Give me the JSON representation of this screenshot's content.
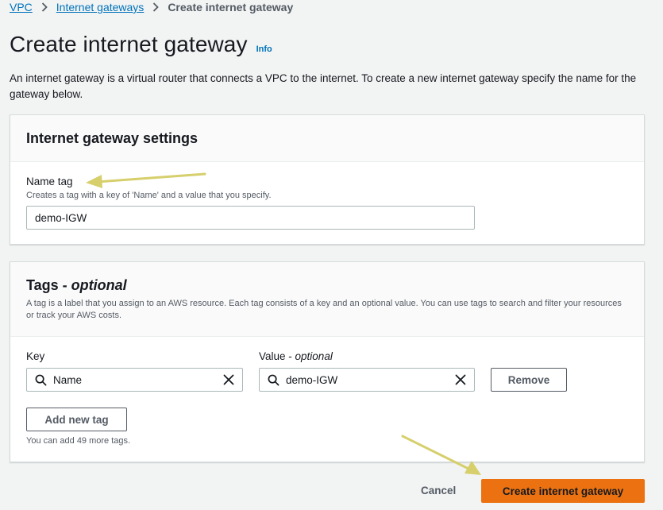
{
  "breadcrumb": {
    "items": [
      {
        "label": "VPC"
      },
      {
        "label": "Internet gateways"
      },
      {
        "label": "Create internet gateway"
      }
    ]
  },
  "header": {
    "title": "Create internet gateway",
    "info": "Info",
    "description": "An internet gateway is a virtual router that connects a VPC to the internet. To create a new internet gateway specify the name for the gateway below."
  },
  "settings_panel": {
    "title": "Internet gateway settings",
    "name_tag_label": "Name tag",
    "name_tag_hint": "Creates a tag with a key of 'Name' and a value that you specify.",
    "name_tag_value": "demo-IGW"
  },
  "tags_panel": {
    "title_main": "Tags - ",
    "title_optional": "optional",
    "description": "A tag is a label that you assign to an AWS resource. Each tag consists of a key and an optional value. You can use tags to search and filter your resources or track your AWS costs.",
    "key_label": "Key",
    "value_label_main": "Value - ",
    "value_label_optional": "optional",
    "rows": [
      {
        "key": "Name",
        "value": "demo-IGW"
      }
    ],
    "remove_label": "Remove",
    "add_new_tag_label": "Add new tag",
    "remaining_hint": "You can add 49 more tags."
  },
  "footer": {
    "cancel_label": "Cancel",
    "create_label": "Create internet gateway"
  },
  "colors": {
    "primary_button": "#ec7211",
    "link": "#0073bb",
    "annotation_arrow": "#d6cf6b"
  }
}
